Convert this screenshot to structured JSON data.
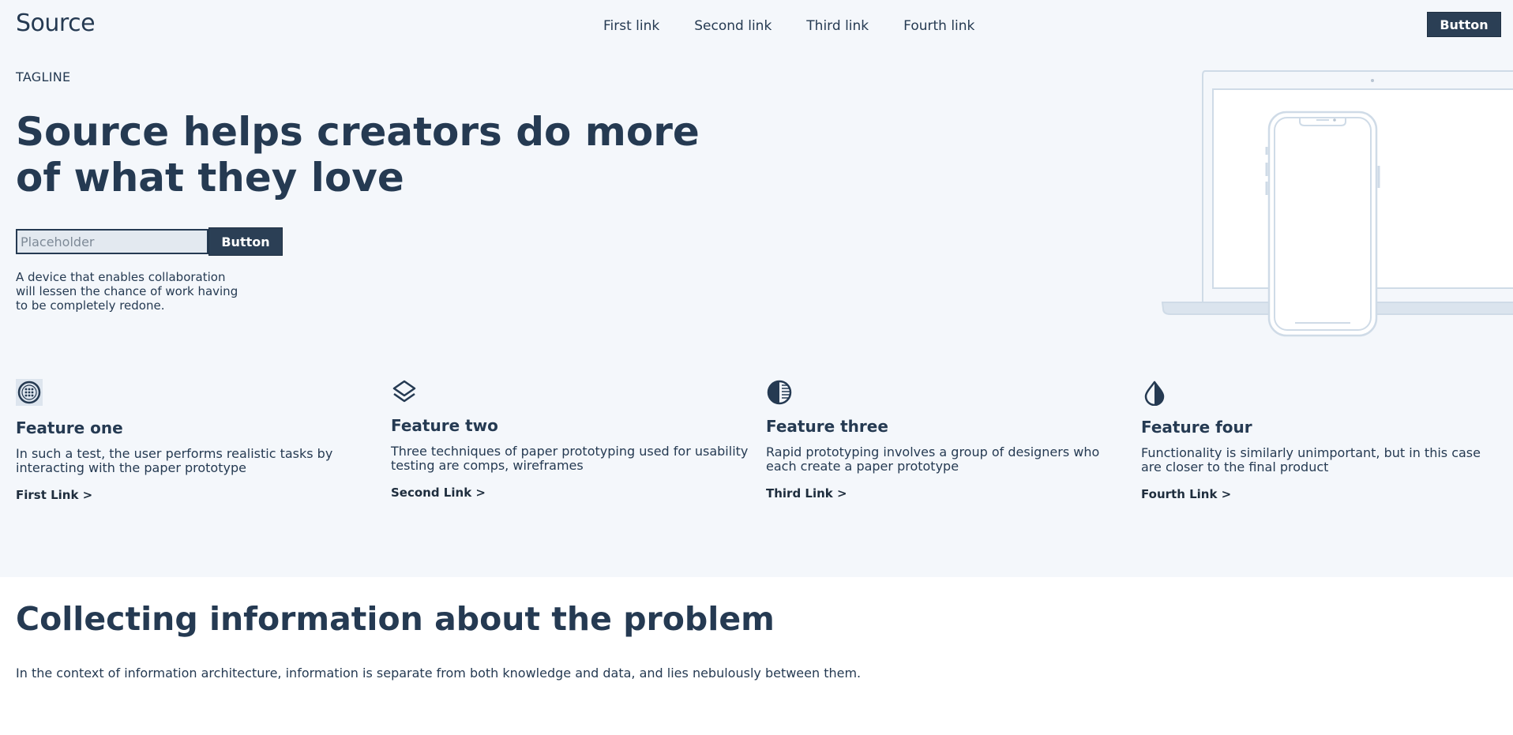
{
  "header": {
    "brand": "Source",
    "nav": [
      "First link",
      "Second link",
      "Third link",
      "Fourth link"
    ],
    "button": "Button"
  },
  "hero": {
    "tagline": "TAGLINE",
    "headline": "Source helps creators do more of what they love",
    "input_placeholder": "Placeholder",
    "button": "Button",
    "description": "A device that enables collaboration will lessen the chance of work having to be completely redone."
  },
  "features": [
    {
      "icon": "globe-icon",
      "title": "Feature one",
      "text": "In such a test, the user performs realistic tasks by interacting with the paper prototype",
      "link": "First Link >"
    },
    {
      "icon": "layers-icon",
      "title": "Feature two",
      "text": "Three techniques of paper prototyping used for usability testing are comps, wireframes",
      "link": "Second Link >"
    },
    {
      "icon": "half-circle-icon",
      "title": "Feature three",
      "text": "Rapid prototyping involves a group of designers who each create a paper prototype",
      "link": "Third Link >"
    },
    {
      "icon": "drop-icon",
      "title": "Feature four",
      "text": "Functionality is similarly unimportant, but in this case are closer to the final product",
      "link": "Fourth Link >"
    }
  ],
  "section": {
    "title": "Collecting information about the problem",
    "text": "In the context of information architecture, information is separate from both knowledge and data, and lies nebulously between them."
  },
  "colors": {
    "primary": "#253a52",
    "button": "#2b3f55",
    "hero_bg": "#f4f7fb",
    "device_line": "#cfdbe7"
  }
}
